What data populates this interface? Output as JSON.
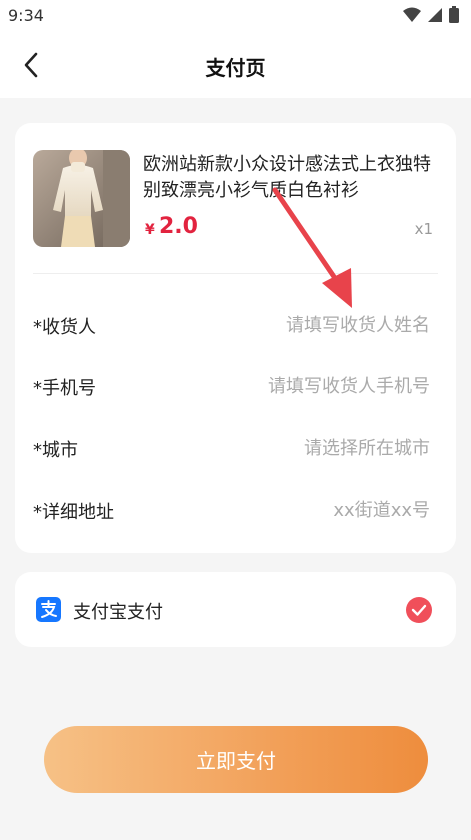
{
  "status_bar": {
    "time": "9:34"
  },
  "header": {
    "title": "支付页"
  },
  "product": {
    "name": "欧洲站新款小众设计感法式上衣独特别致漂亮小衫气质白色衬衫",
    "currency": "¥",
    "price": "2.0",
    "quantity": "x1"
  },
  "form": {
    "fields": [
      {
        "label": "*收货人",
        "placeholder": "请填写收货人姓名"
      },
      {
        "label": "*手机号",
        "placeholder": "请填写收货人手机号"
      },
      {
        "label": "*城市",
        "placeholder": "请选择所在城市"
      },
      {
        "label": "*详细地址",
        "placeholder": "xx街道xx号"
      }
    ]
  },
  "payment": {
    "method_label": "支付宝支付",
    "selected": true
  },
  "submit": {
    "label": "立即支付"
  },
  "colors": {
    "accent": "#ee8d3d",
    "price": "#e2233f",
    "check": "#f04f5a",
    "alipay": "#1677ff",
    "annotation_arrow": "#e8434b"
  }
}
